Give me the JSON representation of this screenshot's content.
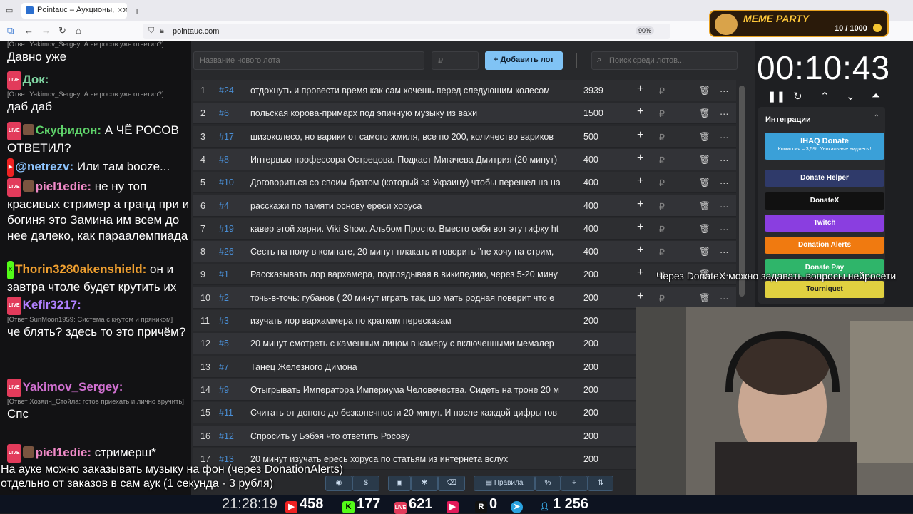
{
  "browser": {
    "tab_title": "Pointauc – Аукционы, лотереи",
    "url": "pointauc.com",
    "zoom": "90%"
  },
  "meme_party": {
    "title": "MEME PARTY",
    "count": "10 / 1000"
  },
  "chat": {
    "messages": [
      {
        "reply": "[Ответ Yakimov_Sergey: А че росов уже ответил?]",
        "text": "Давно уже"
      },
      {
        "user": "Док:",
        "reply": "[Ответ Yakimov_Sergey: А че росов уже ответил?]",
        "text": "даб даб"
      },
      {
        "user": "Скуфидон:",
        "text": "А ЧЁ РОСОВ ОТВЕТИЛ?"
      },
      {
        "user": "@netrezv:",
        "text": "Или там booze..."
      },
      {
        "user": "piel1edie:",
        "text": "не ну топ красивых стример а гранд при и богиня это Замина им всем до нее далеко, как параалемпиада"
      },
      {
        "user": "Thorin3280akenshield:",
        "text": "он и завтра чтоле будет крутить их"
      },
      {
        "user": "Kefir3217:",
        "reply": "[Ответ SunMoon1959: Система с кнутом и пряником]",
        "text": "че блять? здесь то это причём?"
      },
      {
        "user": "Yakimov_Sergey:",
        "reply": "[Ответ Хозяин_Стойла: готов приехать и лично вручить]",
        "text": "Спс"
      },
      {
        "user": "piel1edie:",
        "text": "стримерш*"
      }
    ]
  },
  "auction": {
    "new_lot_placeholder": "Название нового лота",
    "cost_placeholder": "₽",
    "add_button": "Добавить лот",
    "search_placeholder": "Поиск среди лотов...",
    "currency": "₽",
    "lots": [
      {
        "n": "1",
        "id": "#24",
        "name": "отдохнуть и провести время как сам хочешь перед следующим колесом",
        "amount": "3939"
      },
      {
        "n": "2",
        "id": "#6",
        "name": "польская корова-примарх под эпичную музыку из вахи",
        "amount": "1500"
      },
      {
        "n": "3",
        "id": "#17",
        "name": "шизоколесо, но варики от самого жмиля, все по 200, количество вариков",
        "amount": "500"
      },
      {
        "n": "4",
        "id": "#8",
        "name": "Интервью профессора Острецова. Подкаст Мигачева Дмитрия (20 минут)",
        "amount": "400"
      },
      {
        "n": "5",
        "id": "#10",
        "name": "Договориться со своим братом (который за Украину) чтобы перешел на на",
        "amount": "400"
      },
      {
        "n": "6",
        "id": "#4",
        "name": "расскажи по памяти основу ереси хоруса",
        "amount": "400"
      },
      {
        "n": "7",
        "id": "#19",
        "name": "кавер этой херни. Viki Show. Альбом Просто. Вместо себя вот эту гифку ht",
        "amount": "400"
      },
      {
        "n": "8",
        "id": "#26",
        "name": "Сесть на полу в комнате, 20 минут плакать и говорить \"не хочу на стрим, ",
        "amount": "400"
      },
      {
        "n": "9",
        "id": "#1",
        "name": "Рассказывать лор вархамера, подглядывая в википедию, через 5-20 мину",
        "amount": "200"
      },
      {
        "n": "10",
        "id": "#2",
        "name": "точь-в-точь: губанов ( 20 минут играть так, шо мать родная поверит что е",
        "amount": "200"
      },
      {
        "n": "11",
        "id": "#3",
        "name": "изучать лор вархаммера по кратким пересказам",
        "amount": "200"
      },
      {
        "n": "12",
        "id": "#5",
        "name": "20 минут смотреть с каменным лицом в камеру с включенными мемалер",
        "amount": "200"
      },
      {
        "n": "13",
        "id": "#7",
        "name": "Танец Железного Димона",
        "amount": "200"
      },
      {
        "n": "14",
        "id": "#9",
        "name": "Отыгрывать Императора Империума Человечества. Сидеть на троне 20 м",
        "amount": "200"
      },
      {
        "n": "15",
        "id": "#11",
        "name": "Считать от доного до безконечности 20 минут. И после каждой цифры гов",
        "amount": "200"
      },
      {
        "n": "16",
        "id": "#12",
        "name": "Спросить у Бэбэя что ответить Росову",
        "amount": "200"
      },
      {
        "n": "17",
        "id": "#13",
        "name": "20 минут изучать ересь хоруса по статьям из интернета вслух",
        "amount": "200"
      }
    ]
  },
  "timer": {
    "value": "00:10:43"
  },
  "integrations": {
    "title": "Интеграции",
    "ihaq": {
      "label": "IHAQ Donate",
      "sub": "Комиссия – 3,5%. Уникальные виджеты!"
    },
    "buttons": [
      "Donate Helper",
      "DonateX",
      "Twitch",
      "Donation Alerts",
      "Donate Pay",
      "Tourniquet"
    ],
    "colors": [
      "#2f3a6a",
      "#111111",
      "#8a3ee0",
      "#f07a10",
      "#2fb56a",
      "#e0d040"
    ]
  },
  "overlay": {
    "right_text": "Через DonateX можно задавать вопросы нейросети",
    "bottom_line1": "На ауке можно заказывать музыку на фон (через DonationAlerts)",
    "bottom_line2": "отдельно от заказов в сам аук (1 секунда - 3 рубля)"
  },
  "toolbar": {
    "rules_label": "Правила"
  },
  "statusbar": {
    "time": "21:28:19",
    "youtube": "458",
    "kick": "177",
    "vklive": "621",
    "rutube": "0",
    "viewers": "1 256"
  }
}
